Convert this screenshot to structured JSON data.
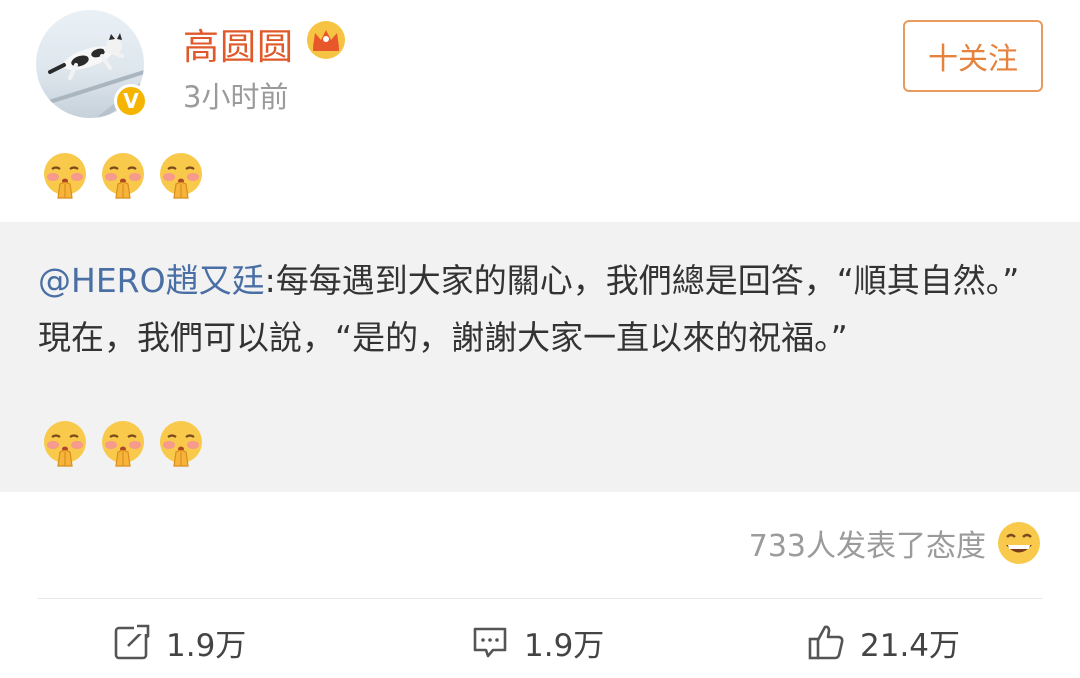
{
  "header": {
    "username": "高圆圆",
    "timestamp": "3小时前",
    "follow_label": "十关注",
    "verified_mark": "V"
  },
  "post": {
    "emojis_top": [
      "blush-hands-emoji",
      "blush-hands-emoji",
      "blush-hands-emoji"
    ],
    "repost": {
      "mention": "@HERO趙又廷",
      "text_part1": ":每每遇到大家的關心，我們總是回答，“順其自然。”",
      "text_part2": "現在，我們可以說，“是的，謝謝大家一直以來的祝福。”"
    },
    "emojis_bottom": [
      "blush-hands-emoji",
      "blush-hands-emoji",
      "blush-hands-emoji"
    ]
  },
  "reactions": {
    "summary": "733人发表了态度",
    "icon": "grin-emoji"
  },
  "actions": {
    "repost_count": "1.9万",
    "comment_count": "1.9万",
    "like_count": "21.4万"
  },
  "colors": {
    "username": "#e0592a",
    "follow": "#e6823c",
    "mention": "#4a6fa5",
    "repost_bg": "#f2f2f2",
    "verified": "#f4b400"
  }
}
